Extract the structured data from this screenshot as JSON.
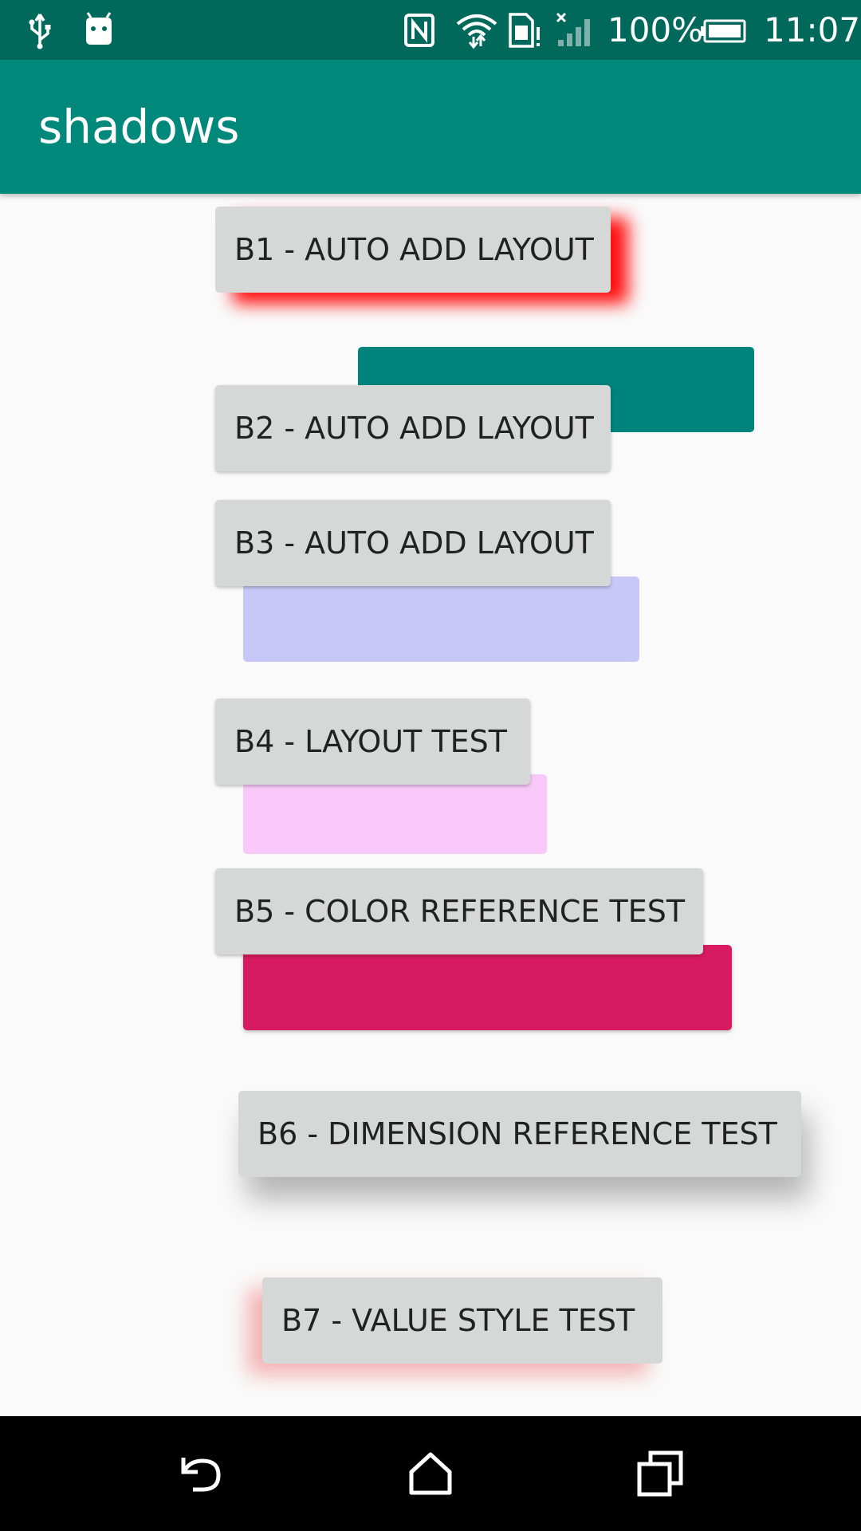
{
  "status_bar": {
    "time": "11:07",
    "battery": "100%",
    "icons": [
      "usb-icon",
      "android-debug-icon",
      "nfc-icon",
      "wifi-icon",
      "sim-alert-icon",
      "signal-icon",
      "battery-icon"
    ]
  },
  "app_bar": {
    "title": "shadows"
  },
  "buttons": [
    {
      "label": "B1 - AUTO ADD LAYOUT"
    },
    {
      "label": "B2 - AUTO ADD LAYOUT"
    },
    {
      "label": "B3 - AUTO ADD LAYOUT"
    },
    {
      "label": "B4 - LAYOUT TEST"
    },
    {
      "label": "B5 - COLOR REFERENCE TEST"
    },
    {
      "label": "B6 - DIMENSION REFERENCE TEST"
    },
    {
      "label": "B7 - VALUE STYLE TEST"
    }
  ],
  "colors": {
    "status_bar": "#00695c",
    "app_bar": "#00897b",
    "button": "#d6d7d7",
    "b1_shadow": "#ff0000",
    "teal_block": "#00837b",
    "lavender_block": "#c8c8f8",
    "pink_block": "#f8c8f8",
    "crimson_block": "#d81b60"
  },
  "nav_bar": {
    "icons": [
      "back-icon",
      "home-icon",
      "recents-icon"
    ]
  }
}
